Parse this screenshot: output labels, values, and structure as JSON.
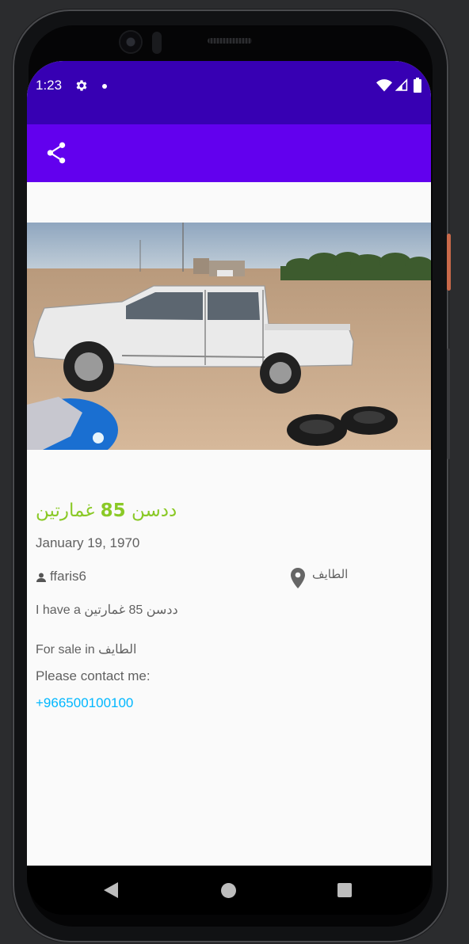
{
  "status_bar": {
    "time": "1:23",
    "icons": [
      "gear-icon",
      "notification-dot-icon",
      "wifi-icon",
      "signal-icon",
      "battery-icon"
    ]
  },
  "toolbar": {
    "share_icon": "share-icon"
  },
  "listing": {
    "title_word1": "ددسن",
    "title_number": "85",
    "title_word2": "غمارتين",
    "date": "January 19, 1970",
    "username": "ffaris6",
    "location": "الطايف",
    "description": "I have a ددسن 85 غمارتين",
    "for_sale": "For sale in الطايف",
    "contact_prompt": "Please contact me:",
    "phone": "+966500100100"
  },
  "nav_bar": {
    "icons": [
      "back-icon",
      "home-icon",
      "recents-icon"
    ]
  },
  "colors": {
    "status_bar": "#3700b3",
    "toolbar": "#6200ee",
    "title": "#8ac926",
    "link": "#00b7ff",
    "text": "#616161"
  }
}
